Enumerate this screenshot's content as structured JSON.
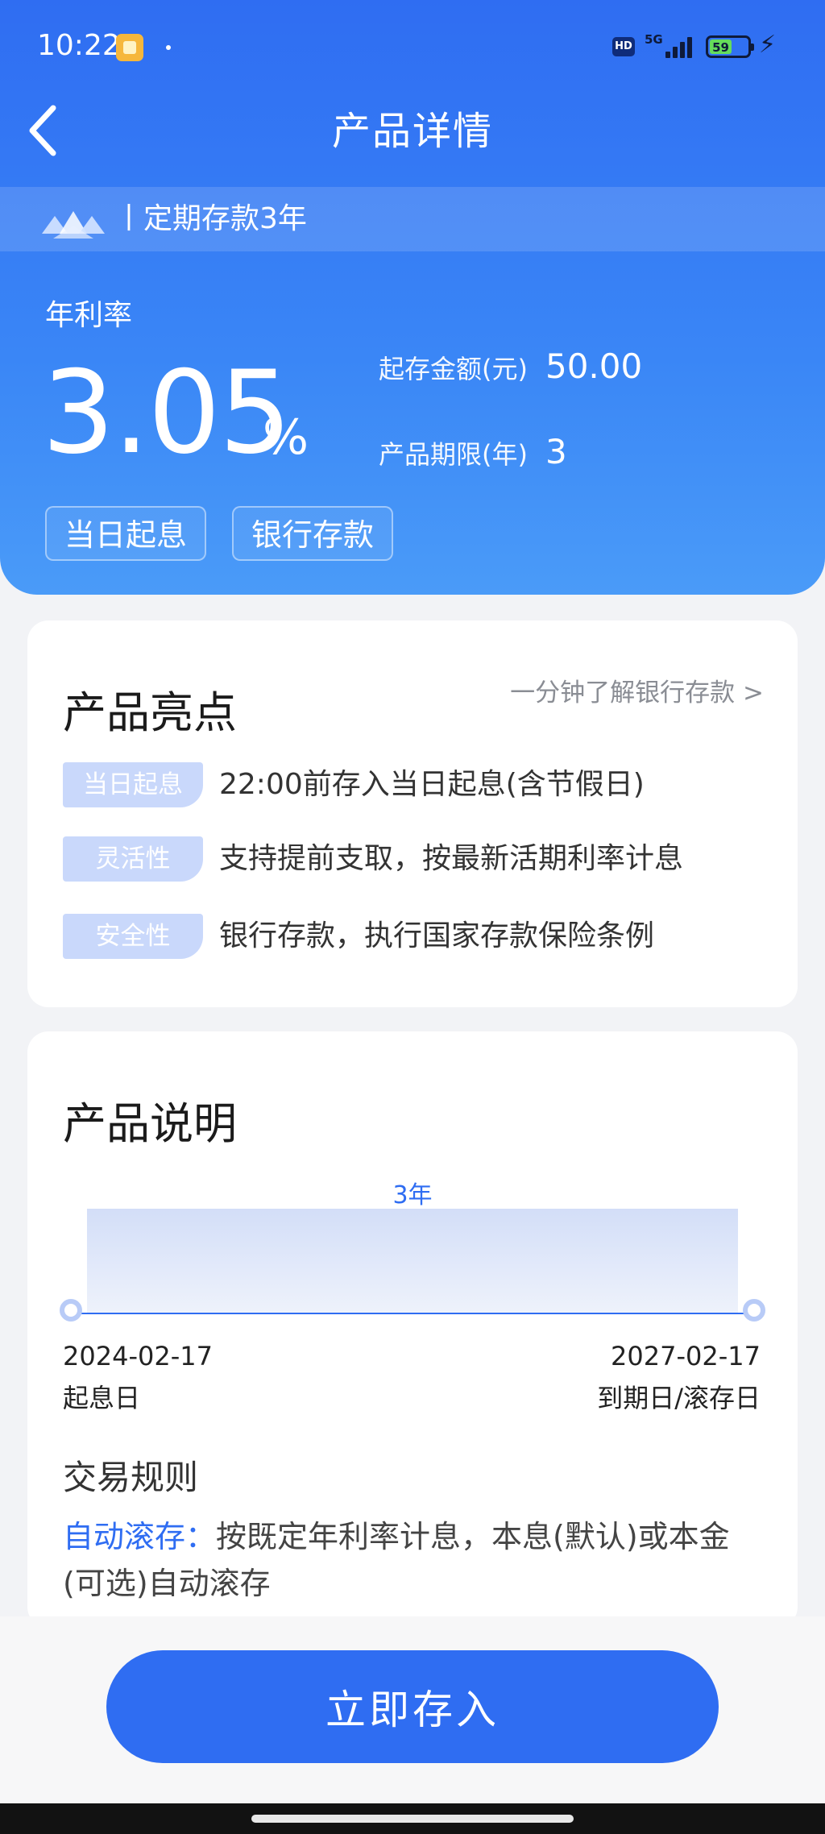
{
  "status_bar": {
    "time": "10:22",
    "network": "5G",
    "hd": "HD",
    "battery": "59"
  },
  "nav": {
    "title": "产品详情"
  },
  "product": {
    "name": "丨定期存款3年",
    "rate_label": "年利率",
    "rate_value": "3.05",
    "rate_unit": "%",
    "min_amount_label": "起存金额(元)",
    "min_amount": "50.00",
    "term_label": "产品期限(年)",
    "term": "3",
    "tags": [
      "当日起息",
      "银行存款"
    ]
  },
  "highlights": {
    "title": "产品亮点",
    "link": "一分钟了解银行存款 >",
    "items": [
      {
        "badge": "当日起息",
        "text": "22:00前存入当日起息(含节假日)"
      },
      {
        "badge": "灵活性",
        "text": "支持提前支取，按最新活期利率计息"
      },
      {
        "badge": "安全性",
        "text": "银行存款，执行国家存款保险条例"
      }
    ]
  },
  "description": {
    "title": "产品说明",
    "period": "3年",
    "start_date": "2024-02-17",
    "start_label": "起息日",
    "end_date": "2027-02-17",
    "end_label": "到期日/滚存日",
    "rules_title": "交易规则",
    "rule_key": "自动滚存：",
    "rule_text": "按既定年利率计息，本息(默认)或本金(可选)自动滚存"
  },
  "action": {
    "deposit_label": "立即存入"
  },
  "colors": {
    "primary": "#2f6df2",
    "badge": "#c9d8fb",
    "background": "#f2f3f6"
  }
}
